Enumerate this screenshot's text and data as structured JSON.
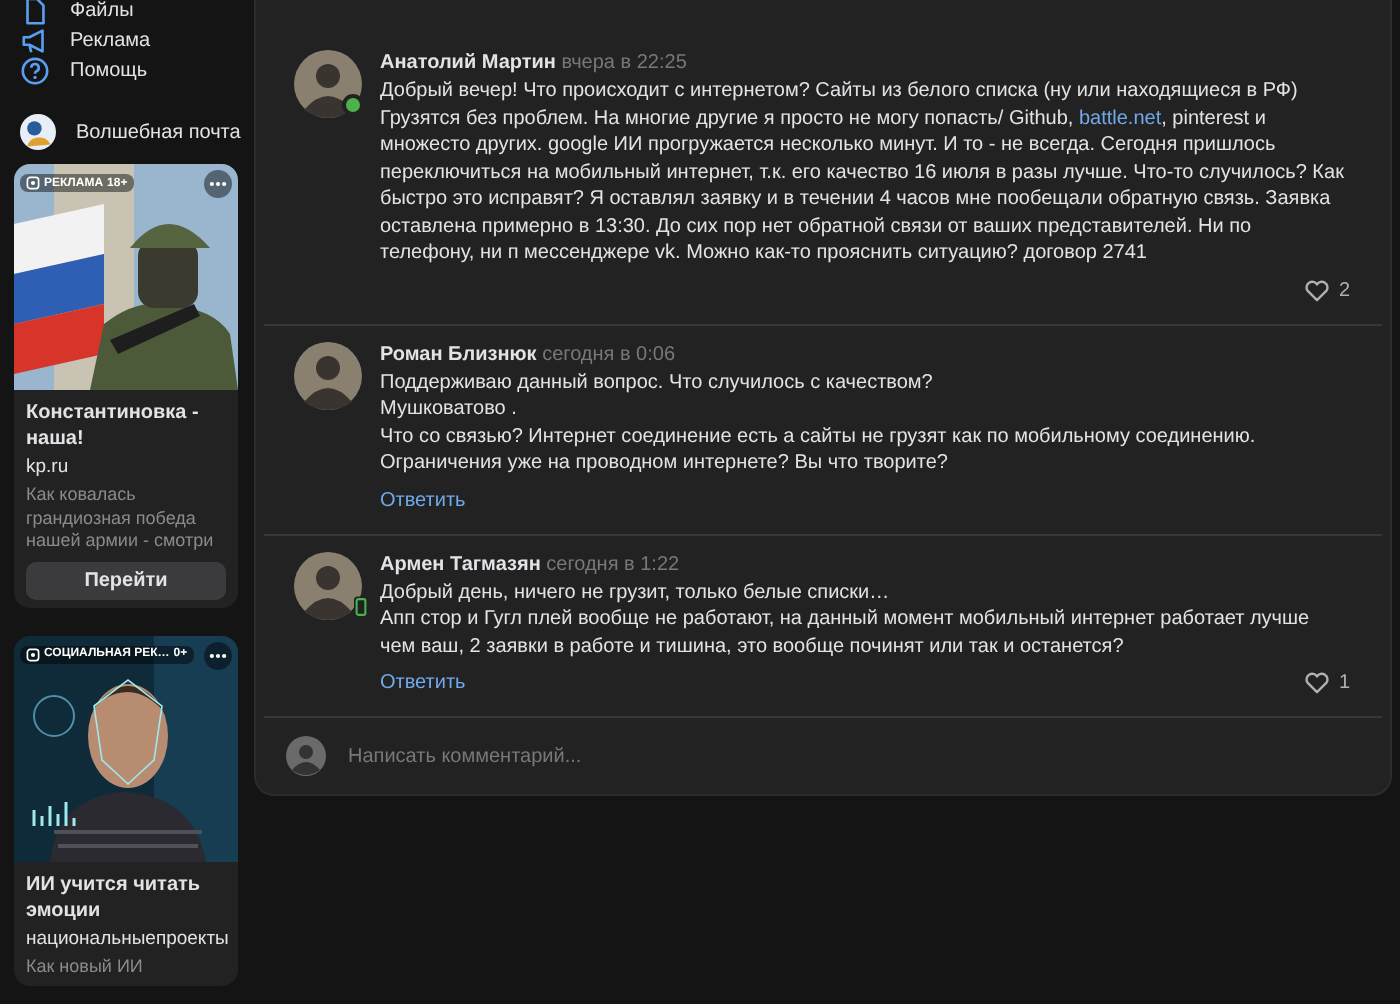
{
  "sidebar": {
    "items": [
      {
        "label": "Файлы"
      },
      {
        "label": "Реклама"
      },
      {
        "label": "Помощь"
      }
    ],
    "app": {
      "label": "Волшебная почта"
    },
    "ads": [
      {
        "kind": "picture",
        "tag": "РЕКЛАМА",
        "age": "18+",
        "title": "Константиновка - наша!",
        "domain": "kp.ru",
        "description": "Как ковалась грандиозная победа нашей армии - смотри",
        "button": "Перейти"
      },
      {
        "kind": "picture",
        "tag": "СОЦИАЛЬНАЯ РЕК…",
        "age": "0+",
        "title": "ИИ учится читать эмоции",
        "domain": "национальныепроекты",
        "description": "Как новый ИИ"
      }
    ]
  },
  "comments": [
    {
      "author": "Анатолий Мартин",
      "time": "вчера в 22:25",
      "online": true,
      "mobile": false,
      "paragraphs": [
        [
          {
            "kind": "text",
            "text": "Добрый вечер! Что происходит с интернетом? Сайты из белого списка (ну или находящиеся в РФ) Грузятся без проблем. На многие другие я просто не могу попасть/ Github, "
          },
          {
            "kind": "link",
            "text": "battle.net"
          },
          {
            "kind": "text",
            "text": ", pinterest и множесто других. google ИИ прогружается несколько минут. И то - не всегда. Сегодня пришлось переключиться на мобильный интернет, т.к. его качество 16 июля в разы лучше. Что-то случилось? Как быстро это исправят? Я оставлял заявку и в течении 4 часов мне пообещали обратную связь. Заявка оставлена примерно в 13:30. До сих пор нет обратной связи от ваших представителей. Ни по телефону, ни п мессенджере vk. Можно как-то прояснить ситуацию? договор 2741"
          }
        ]
      ],
      "likes": "2"
    },
    {
      "author": "Роман Близнюк",
      "time": "сегодня в 0:06",
      "paragraphs": [
        [
          {
            "kind": "text",
            "text": "Поддерживаю данный вопрос. Что случилось с качеством?"
          }
        ],
        [
          {
            "kind": "text",
            "text": "Мушковатово ."
          }
        ],
        [
          {
            "kind": "text",
            "text": "Что со связью? Интернет соединение есть а сайты не грузят как по мобильному соединению. Ограничения уже на проводном интернете? Вы что творите?"
          }
        ]
      ],
      "reply": "Ответить"
    },
    {
      "author": "Армен Тагмазян",
      "time": "сегодня в 1:22",
      "online": true,
      "mobile": true,
      "paragraphs": [
        [
          {
            "kind": "text",
            "text": "Добрый день, ничего не грузит, только белые списки…"
          }
        ],
        [
          {
            "kind": "text",
            "text": "Апп стор и Гугл плей вообще не работают, на данный момент мобильный интернет работает лучше чем ваш, 2 заявки в работе и тишина, это вообще починят или так и останется?"
          }
        ]
      ],
      "reply": "Ответить",
      "likes": "1"
    }
  ],
  "composer": {
    "placeholder": "Написать комментарий..."
  }
}
